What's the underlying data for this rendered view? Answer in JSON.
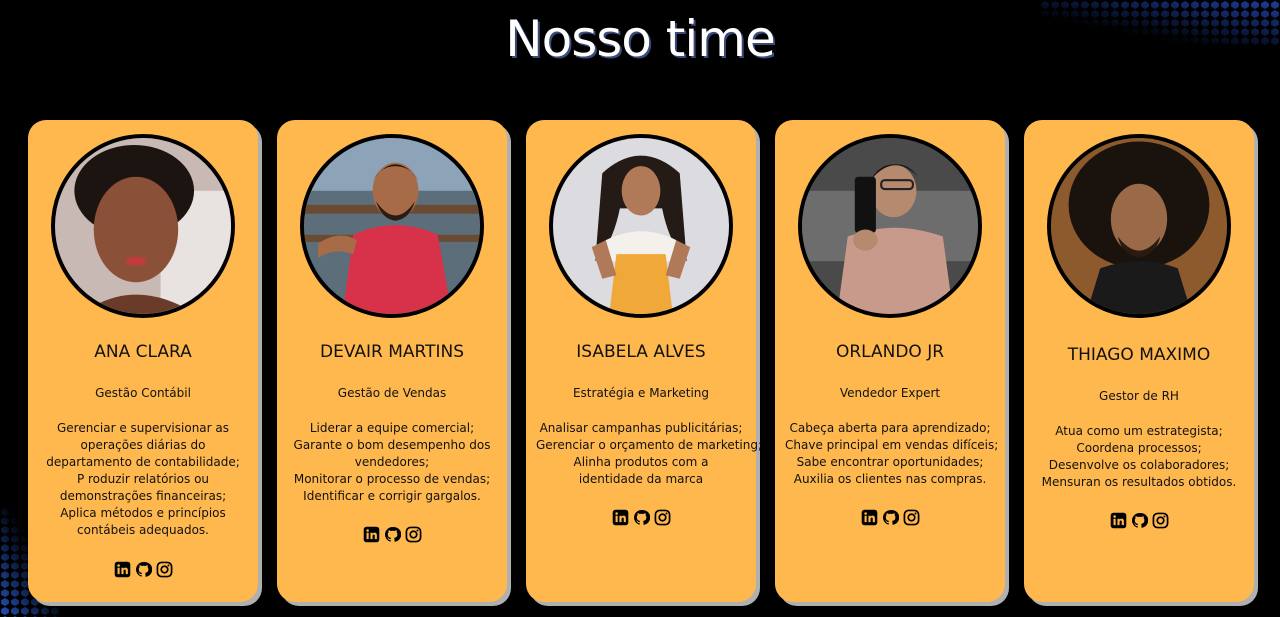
{
  "page": {
    "title": "Nosso time"
  },
  "colors": {
    "background": "#000000",
    "card": "#ffb84d",
    "card_shadow": "#b0b0b0",
    "hex_accent": "#2c58c8"
  },
  "team": [
    {
      "name": "ANA CLARA",
      "role": "Gestão Contábil",
      "description_lines": [
        "Gerenciar e supervisionar as",
        "operações diárias do",
        "departamento de contabilidade;",
        "P roduzir relatórios ou",
        "demonstrações financeiras;",
        "Aplica métodos e princípios",
        "contábeis adequados."
      ],
      "socials": [
        "linkedin-icon",
        "github-icon",
        "instagram-icon"
      ]
    },
    {
      "name": "DEVAIR MARTINS",
      "role": "Gestão de Vendas",
      "description_lines": [
        "Liderar a equipe comercial;",
        "Garante o bom desempenho dos",
        "vendedores;",
        "Monitorar o processo de vendas;",
        "Identificar e corrigir gargalos."
      ],
      "socials": [
        "linkedin-icon",
        "github-icon",
        "instagram-icon"
      ]
    },
    {
      "name": "ISABELA ALVES",
      "role": "Estratégia e Marketing",
      "description_lines": [
        "Analisar campanhas publicitárias;",
        "Gerenciar o orçamento de marketing;",
        "Alinha produtos com a",
        "identidade da marca"
      ],
      "socials": [
        "linkedin-icon",
        "github-icon",
        "instagram-icon"
      ]
    },
    {
      "name": "ORLANDO JR",
      "role": "Vendedor Expert",
      "description_lines": [
        "Cabeça aberta para aprendizado;",
        "Chave principal em vendas difíceis;",
        "Sabe encontrar oportunidades;",
        "Auxilia os clientes nas compras."
      ],
      "socials": [
        "linkedin-icon",
        "github-icon",
        "instagram-icon"
      ]
    },
    {
      "name": "THIAGO MAXIMO",
      "role": "Gestor de RH",
      "description_lines": [
        "Atua como um estrategista;",
        "Coordena processos;",
        "Desenvolve os colaboradores;",
        "Mensuran os resultados obtidos."
      ],
      "socials": [
        "linkedin-icon",
        "github-icon",
        "instagram-icon"
      ]
    }
  ]
}
